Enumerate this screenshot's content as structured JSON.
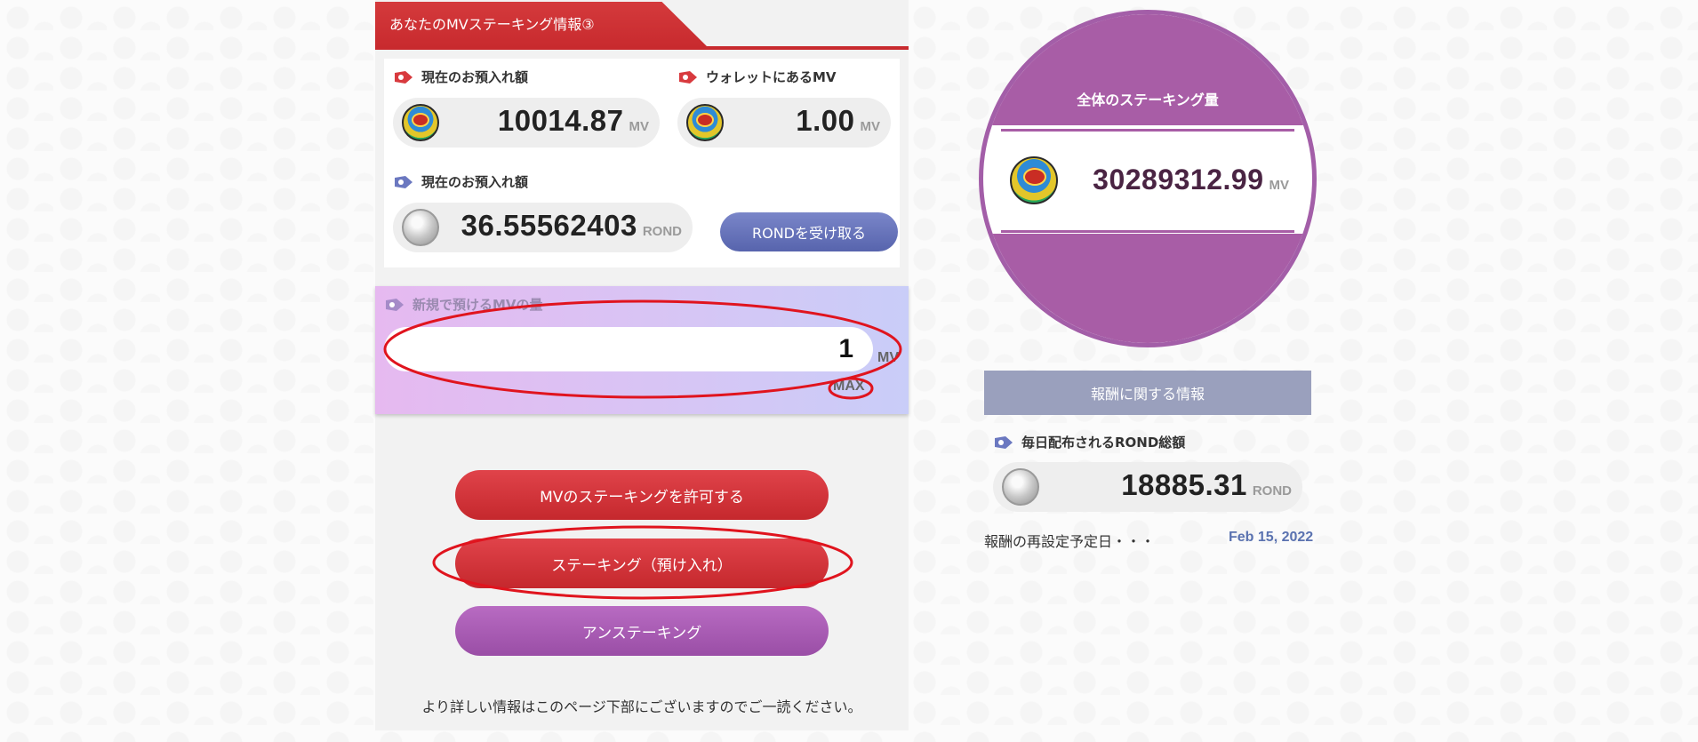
{
  "staking_panel": {
    "tab_title": "あなたのMVステーキング情報③",
    "current_deposit_mv": {
      "label": "現在のお預入れ額",
      "value": "10014.87",
      "unit": "MV"
    },
    "wallet_mv": {
      "label": "ウォレットにあるMV",
      "value": "1.00",
      "unit": "MV"
    },
    "current_deposit_rond": {
      "label": "現在のお預入れ額",
      "value": "36.55562403",
      "unit": "ROND"
    },
    "claim_rond_button": "RONDを受け取る",
    "new_deposit": {
      "label": "新規で預けるMVの量",
      "amount": "1",
      "unit": "MV",
      "max_label": "MAX"
    },
    "buttons": {
      "approve": "MVのステーキングを許可する",
      "stake": "ステーキング（預け入れ）",
      "unstake": "アンステーキング"
    },
    "footnote": "より詳しい情報はこのページ下部にございますのでご一読ください。"
  },
  "total_staking": {
    "title": "全体のステーキング量",
    "value": "30289312.99",
    "unit": "MV"
  },
  "reward_info": {
    "header": "報酬に関する情報",
    "daily_rond": {
      "label": "毎日配布されるROND総額",
      "value": "18885.31",
      "unit": "ROND"
    },
    "reset_label": "報酬の再設定予定日・・・",
    "reset_date": "Feb 15, 2022"
  },
  "colors": {
    "accent_red": "#c82a2e",
    "accent_purple": "#a85da6",
    "rond_blue": "#5764ad",
    "annotation_red": "#e0141e"
  },
  "icons": {
    "tag_red": "red-tag-icon",
    "tag_blue": "blue-tag-icon",
    "mv_coin": "mv-coin-icon",
    "rond_coin": "rond-coin-icon"
  }
}
